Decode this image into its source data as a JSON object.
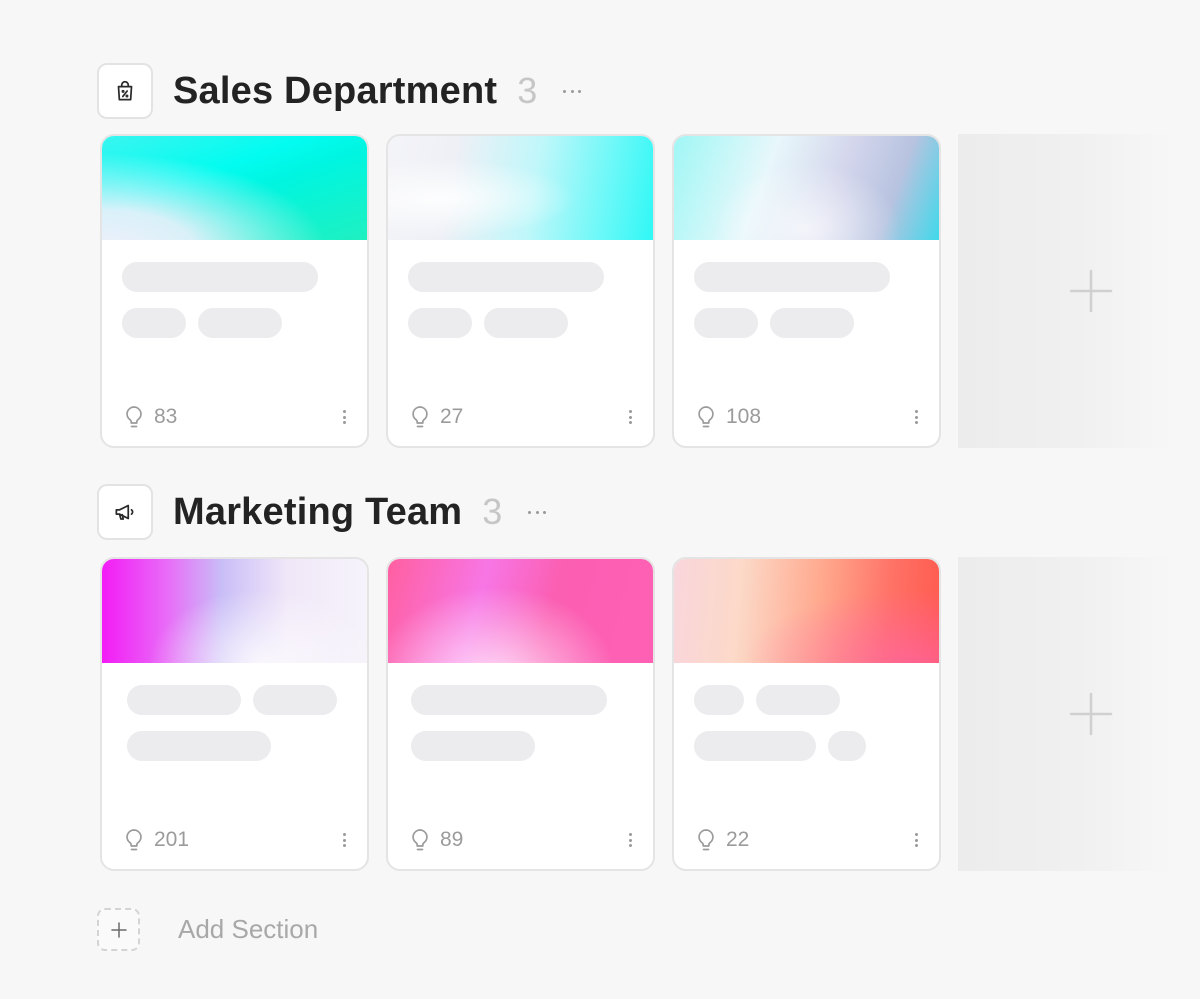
{
  "sections": [
    {
      "title": "Sales Department",
      "count": "3",
      "icon": "shopping-bag-percent-icon",
      "cards": [
        {
          "ideas": "83",
          "cover": "linear-gradient(160deg, #3af5f0 0%, #02fcf0 38%, #00f5e0 55%, #1ff0c0 100%)",
          "cover_overlay": "radial-gradient(ellipse at 0% 110%, #f0f0fb 0%, rgba(240,240,251,0.9) 25%, rgba(255,255,255,0) 60%)",
          "skeleton": [
            [
              196
            ],
            [
              64,
              84
            ]
          ]
        },
        {
          "ideas": "27",
          "cover": "linear-gradient(100deg, #f4f4f8 0%, #eef0f6 25%, #bff7fa 55%, #2ff8f6 100%)",
          "cover_overlay": "radial-gradient(ellipse at 20% 60%, rgba(255,255,255,0.9) 0%, rgba(255,255,255,0) 45%)",
          "skeleton": [
            [
              196
            ],
            [
              64,
              84
            ]
          ]
        },
        {
          "ideas": "108",
          "cover": "linear-gradient(110deg, #9ff7f5 0%, #e8f7fb 35%, #d4d6ec 60%, #b7c3e0 80%, #40d8ea 100%)",
          "cover_overlay": "radial-gradient(ellipse at 50% 90%, rgba(255,255,255,0.7) 0%, rgba(255,255,255,0) 50%)",
          "skeleton": [
            [
              196
            ],
            [
              64,
              84
            ]
          ]
        }
      ]
    },
    {
      "title": "Marketing Team",
      "count": "3",
      "icon": "megaphone-icon",
      "cards": [
        {
          "ideas": "201",
          "cover": "linear-gradient(90deg, #f31bf6 0%, #e86df7 25%, #c9bdf7 45%, #f0e7f8 70%, #f6f3fb 100%)",
          "cover_overlay": "radial-gradient(ellipse at 60% 100%, rgba(255,255,255,0.8) 0%, rgba(255,255,255,0) 50%)",
          "skeleton": [
            [
              114,
              84
            ],
            [
              144
            ]
          ]
        },
        {
          "ideas": "89",
          "cover": "linear-gradient(105deg, #ff5fa0 0%, #f776e5 35%, #fb5fb2 60%, #ff60b4 100%)",
          "cover_overlay": "radial-gradient(ellipse at 40% 120%, rgba(255,230,250,0.95) 0%, rgba(255,230,250,0) 55%)",
          "skeleton": [
            [
              196
            ],
            [
              124
            ]
          ]
        },
        {
          "ideas": "22",
          "cover": "linear-gradient(95deg, #f9d6dc 0%, #fcd9c8 25%, #ffa88d 55%, #ff7266 80%, #ff5a4e 100%)",
          "cover_overlay": "radial-gradient(ellipse at 90% 100%, rgba(255,100,180,0.6) 0%, rgba(255,100,180,0) 50%)",
          "skeleton": [
            [
              50,
              84
            ],
            [
              122,
              38
            ]
          ]
        }
      ]
    }
  ],
  "add_section": {
    "label": "Add Section"
  },
  "colors": {
    "title": "#232323",
    "count": "#c6c6c6",
    "skeleton": "#ececee",
    "background": "#f7f7f7"
  }
}
